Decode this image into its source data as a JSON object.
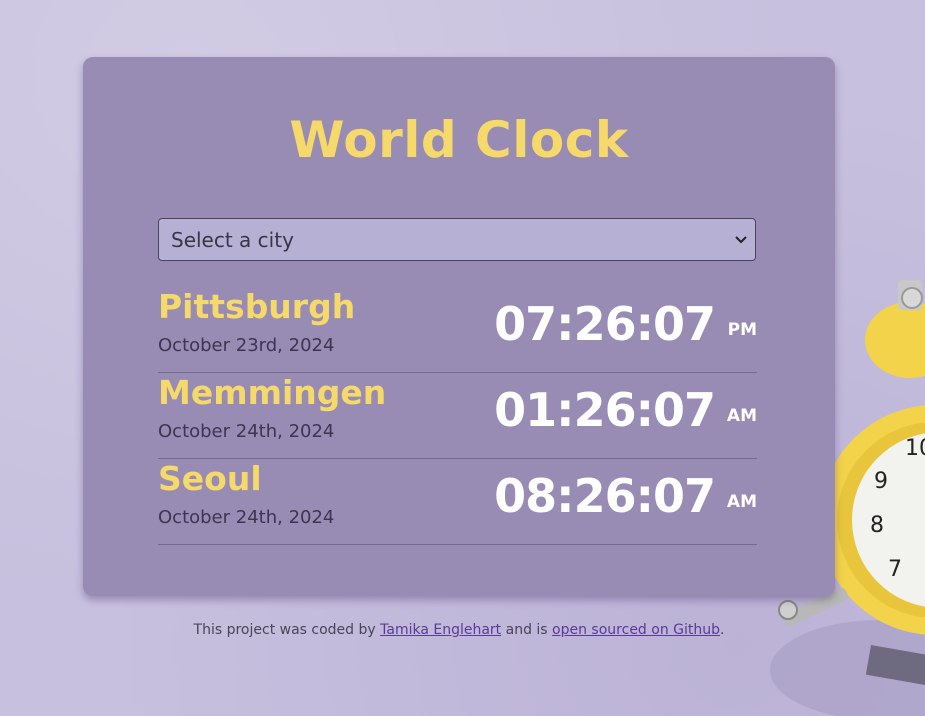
{
  "app": {
    "title": "World Clock"
  },
  "city_select": {
    "placeholder": "Select a city"
  },
  "cities": [
    {
      "name": "Pittsburgh",
      "date": "October 23rd, 2024",
      "time": "07:26:07",
      "ampm": "PM"
    },
    {
      "name": "Memmingen",
      "date": "October 24th, 2024",
      "time": "01:26:07",
      "ampm": "AM"
    },
    {
      "name": "Seoul",
      "date": "October 24th, 2024",
      "time": "08:26:07",
      "ampm": "AM"
    }
  ],
  "footer": {
    "prefix": "This project was coded by ",
    "author_link": "Tamika Englehart",
    "middle": " and is ",
    "source_link": "open sourced on Github",
    "suffix": "."
  },
  "colors": {
    "background": "#c7c0de",
    "card": "#988bb4",
    "accent_yellow": "#f5d96a",
    "time_white": "#ffffff",
    "link": "#5a3a96"
  },
  "icons": {
    "select_chevron": "chevron-down-icon",
    "decoration": "alarm-clock-icon"
  }
}
